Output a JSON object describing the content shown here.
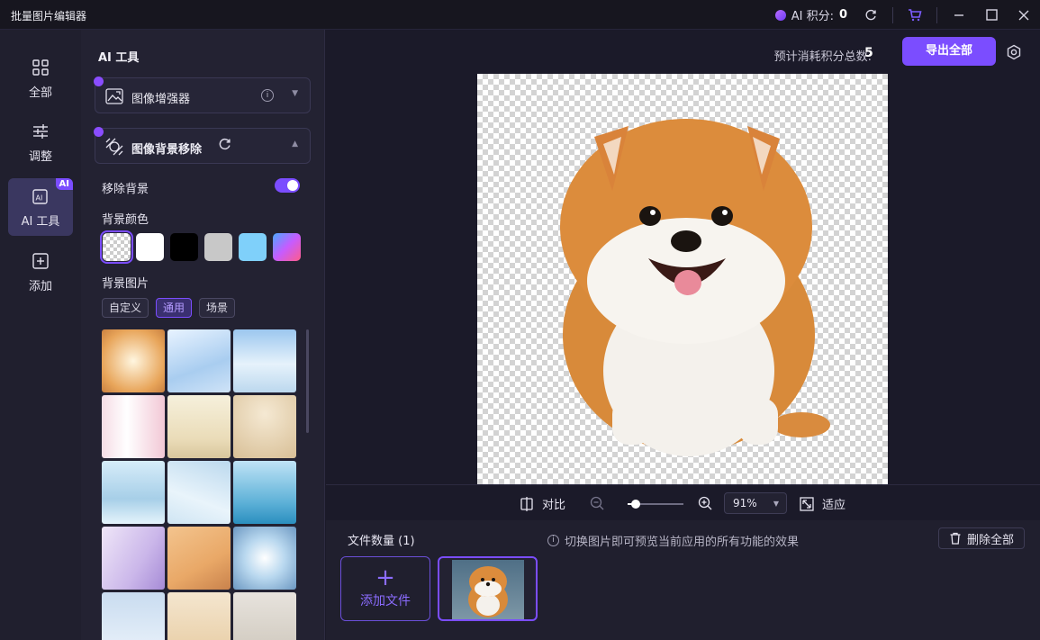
{
  "app": {
    "title": "批量图片编辑器"
  },
  "titlebar": {
    "points_label": "AI 积分:",
    "points_value": "0"
  },
  "rail": {
    "items": [
      {
        "label": "全部"
      },
      {
        "label": "调整"
      },
      {
        "label": "AI 工具",
        "badge": "AI"
      },
      {
        "label": "添加"
      }
    ]
  },
  "panel": {
    "title": "AI 工具",
    "tools": [
      {
        "label": "图像增强器"
      },
      {
        "label": "图像背景移除"
      }
    ],
    "remove_bg_label": "移除背景",
    "bg_color_label": "背景颜色",
    "bg_colors": [
      "transparent",
      "#ffffff",
      "#000000",
      "#c8c8c8",
      "#7fd0fa",
      "gradient"
    ],
    "bg_image_label": "背景图片",
    "bg_image_tabs": [
      {
        "label": "自定义"
      },
      {
        "label": "通用",
        "active": true
      },
      {
        "label": "场景"
      }
    ]
  },
  "main": {
    "estimate_label": "预计消耗积分总数:",
    "estimate_value": "5",
    "export_label": "导出全部",
    "compare_label": "对比",
    "zoom_value": "91%",
    "fit_label": "适应",
    "file_count_label": "文件数量 (1)",
    "hint_text": "切换图片即可预览当前应用的所有功能的效果",
    "delete_all_label": "删除全部",
    "add_file_label": "添加文件"
  },
  "colors": {
    "accent": "#7b4dff",
    "bg": "#1b1a29",
    "panel": "#232232"
  }
}
